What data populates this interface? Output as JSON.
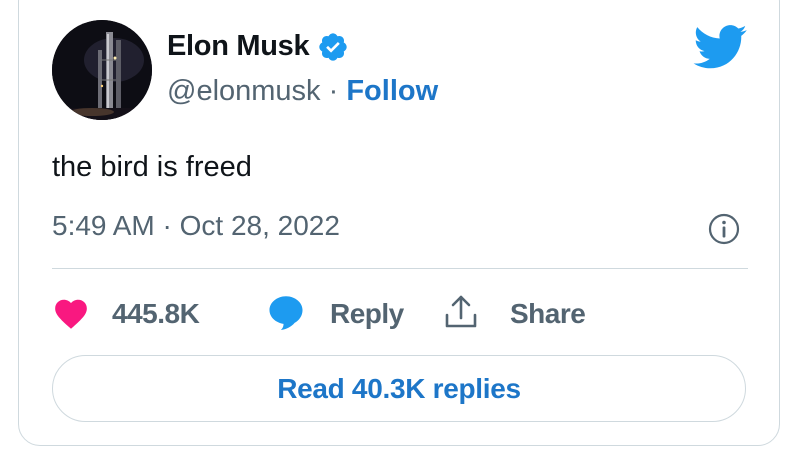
{
  "author": {
    "name": "Elon Musk",
    "handle": "@elonmusk",
    "separator": " · ",
    "follow_label": "Follow",
    "verified": true
  },
  "tweet": {
    "text": "the bird is freed",
    "timestamp": "5:49 AM · Oct 28, 2022"
  },
  "actions": {
    "like_count": "445.8K",
    "reply_label": "Reply",
    "share_label": "Share"
  },
  "read_replies_label": "Read 40.3K replies",
  "icons": {
    "brand": "twitter-bird-icon",
    "verified": "verified-badge-icon",
    "info": "info-icon",
    "like": "heart-icon",
    "reply": "speech-bubble-icon",
    "share": "share-upload-icon"
  },
  "colors": {
    "brand_blue": "#1d9bf0",
    "link_blue": "#1d76c8",
    "like_pink": "#f91880",
    "text_primary": "#0f1419",
    "text_secondary": "#536471",
    "border": "#cfd9de"
  }
}
